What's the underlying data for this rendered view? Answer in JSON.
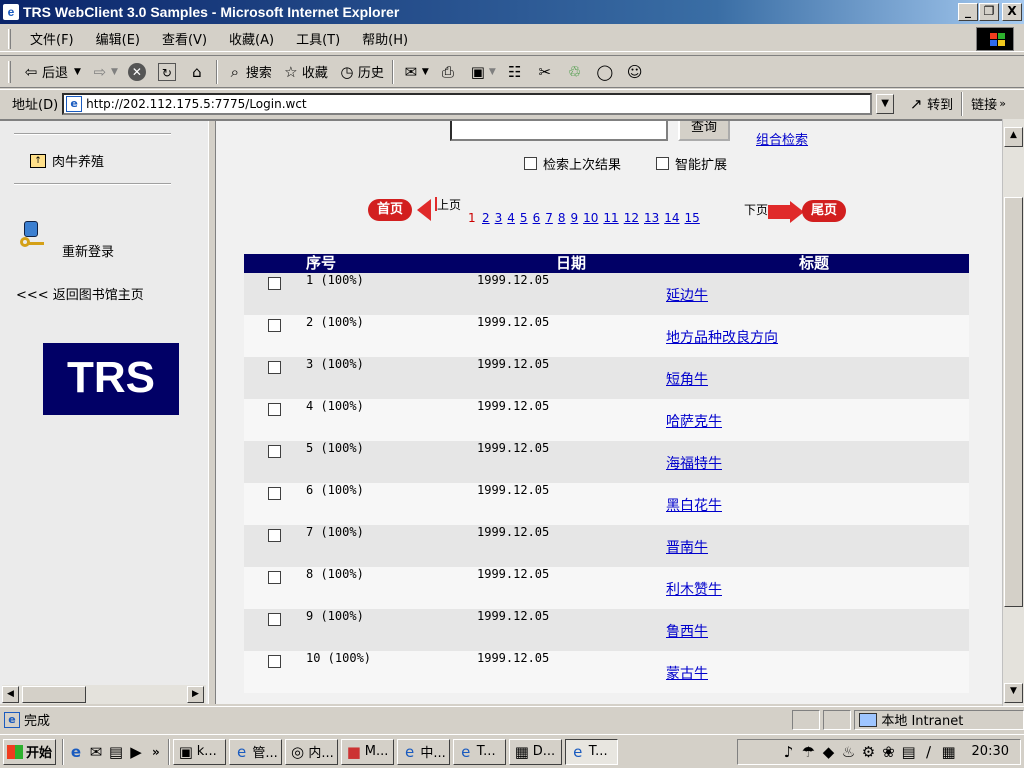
{
  "window": {
    "title": "TRS WebClient 3.0 Samples - Microsoft Internet Explorer",
    "min": "_",
    "max": "&#x25A1;",
    "close": "X"
  },
  "menu": [
    "文件(F)",
    "编辑(E)",
    "查看(V)",
    "收藏(A)",
    "工具(T)",
    "帮助(H)"
  ],
  "toolbar": {
    "back": "后退",
    "search": "搜索",
    "favorites": "收藏",
    "history": "历史"
  },
  "address": {
    "label": "地址(D)",
    "url": "http://202.112.175.5:7775/Login.wct",
    "go": "转到",
    "links": "链接"
  },
  "left_nav": {
    "category": "肉牛养殖",
    "relogin": "重新登录",
    "back_home": "<<< 返回图书馆主页",
    "logo": "TRS"
  },
  "search": {
    "query_button": "查询",
    "combo_link": "组合检索",
    "opt_prev": "检索上次结果",
    "opt_smart": "智能扩展"
  },
  "pager": {
    "first": "首页",
    "prev": "上页",
    "next": "下页",
    "last": "尾页",
    "current": "1",
    "pages": [
      "2",
      "3",
      "4",
      "5",
      "6",
      "7",
      "8",
      "9",
      "10",
      "11",
      "12",
      "13",
      "14",
      "15"
    ]
  },
  "table": {
    "headers": {
      "no": "序号",
      "date": "日期",
      "title": "标题"
    },
    "rows": [
      {
        "no": "1 (100%)",
        "date": "1999.12.05",
        "title": "延边牛"
      },
      {
        "no": "2 (100%)",
        "date": "1999.12.05",
        "title": "地方品种改良方向"
      },
      {
        "no": "3 (100%)",
        "date": "1999.12.05",
        "title": "短角牛"
      },
      {
        "no": "4 (100%)",
        "date": "1999.12.05",
        "title": "哈萨克牛"
      },
      {
        "no": "5 (100%)",
        "date": "1999.12.05",
        "title": "海福特牛"
      },
      {
        "no": "6 (100%)",
        "date": "1999.12.05",
        "title": "黑白花牛"
      },
      {
        "no": "7 (100%)",
        "date": "1999.12.05",
        "title": "晋南牛"
      },
      {
        "no": "8 (100%)",
        "date": "1999.12.05",
        "title": "利木赞牛"
      },
      {
        "no": "9 (100%)",
        "date": "1999.12.05",
        "title": "鲁西牛"
      },
      {
        "no": "10 (100%)",
        "date": "1999.12.05",
        "title": "蒙古牛"
      }
    ]
  },
  "status": {
    "text": "完成",
    "zone": "本地 Intranet"
  },
  "taskbar": {
    "start": "开始",
    "tasks": [
      "k...",
      "管...",
      "内...",
      "M...",
      "中...",
      "T...",
      "D...",
      "T..."
    ],
    "clock": "20:30"
  }
}
